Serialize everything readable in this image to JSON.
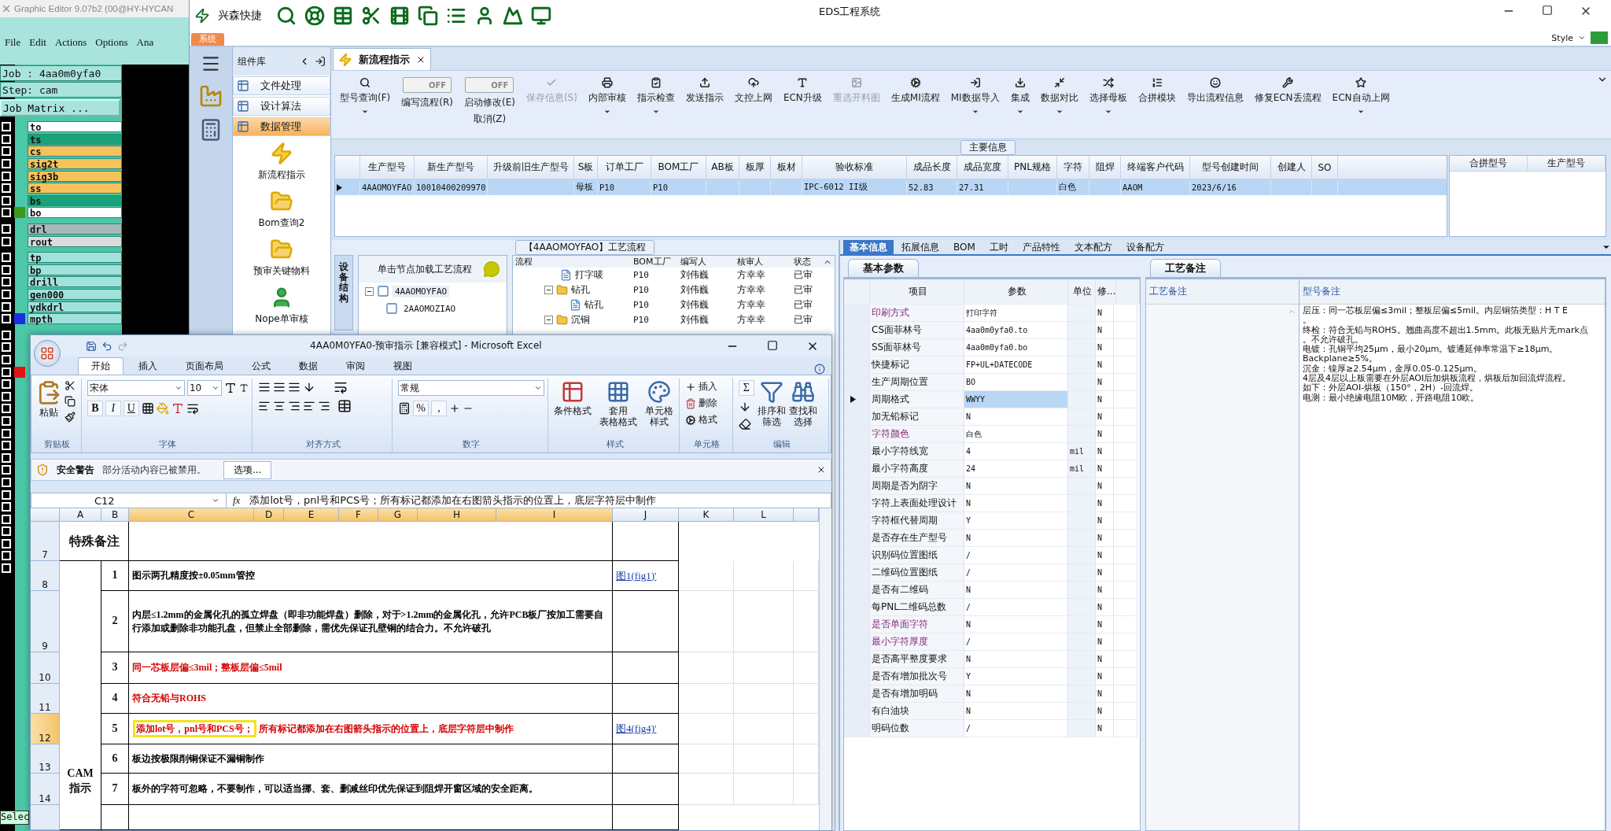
{
  "graphic_editor": {
    "title": "Graphic Editor 9.07b2 (00@HY-HYCAN",
    "menu": [
      "File",
      "Edit",
      "Actions",
      "Options",
      "Ana"
    ],
    "job": "Job : 4aa0m0yfa0",
    "step": "Step: cam",
    "matrix_button": "Job Matrix ...",
    "layer_groups": [
      [
        {
          "name": "to",
          "color": "#ffffff",
          "checked": false
        },
        {
          "name": "ts",
          "color": "#1aa37a",
          "checked": false
        },
        {
          "name": "cs",
          "color": "#f7c25a",
          "checked": false
        },
        {
          "name": "sig2t",
          "color": "#f7c25a",
          "checked": false
        },
        {
          "name": "sig3b",
          "color": "#f7c25a",
          "checked": false
        },
        {
          "name": "ss",
          "color": "#f7c25a",
          "checked": false
        },
        {
          "name": "bs",
          "color": "#1aa37a",
          "checked": false
        },
        {
          "name": "bo",
          "color": "#ffffff",
          "checked": false,
          "marker": {
            "color": "#3e9a1c"
          }
        }
      ],
      [
        {
          "name": "drl",
          "color": "#a9b9bb",
          "checked": false
        },
        {
          "name": "rout",
          "color": "#dcdcdc",
          "checked": false
        }
      ],
      [
        {
          "name": "tp",
          "color": "#a2e2dc",
          "checked": false
        },
        {
          "name": "bp",
          "color": "#a2e2dc",
          "checked": false
        },
        {
          "name": "drill",
          "color": "#a2e2dc",
          "checked": false
        },
        {
          "name": "gen000",
          "color": "#a2e2dc",
          "checked": false
        },
        {
          "name": "ydkdrl",
          "color": "#a2e2dc",
          "checked": false
        },
        {
          "name": "mpth",
          "color": "#a2e2dc",
          "checked": false,
          "marker": {
            "color": "#1c2fe0"
          }
        }
      ]
    ],
    "covered_layers": [
      {
        "checked": false
      },
      {
        "checked": false
      },
      {
        "checked": false
      },
      {
        "checked": false,
        "marker": {
          "color": "#e41414"
        }
      },
      {
        "checked": false
      },
      {
        "checked": false
      },
      {
        "checked": false
      },
      {
        "checked": false
      },
      {
        "checked": false
      },
      {
        "checked": false
      },
      {
        "checked": false
      },
      {
        "checked": false
      },
      {
        "checked": false
      },
      {
        "checked": false
      },
      {
        "checked": false
      },
      {
        "checked": false
      },
      {
        "checked": false
      },
      {
        "checked": false
      },
      {
        "checked": false
      },
      {
        "checked": false
      }
    ],
    "select_label": "Selec"
  },
  "eds": {
    "brand": "兴森快捷",
    "title": "EDS工程系统",
    "system_tab": "系统",
    "style_label": "Style",
    "library_title": "组件库",
    "nav_groups": [
      {
        "label": "文件处理",
        "selected": false
      },
      {
        "label": "设计算法",
        "selected": false
      },
      {
        "label": "数据管理",
        "selected": true
      }
    ],
    "modules": [
      "新流程指示",
      "Bom查询2",
      "预审关键物料",
      "Nope单审核"
    ],
    "doc_tab": "新流程指示",
    "ribbon": [
      {
        "kind": "button",
        "label": "型号查询(F)",
        "dropdown": true,
        "disabled": false
      },
      {
        "kind": "toggle",
        "label": "编写流程(R)",
        "state_text": "OFF",
        "on": false
      },
      {
        "kind": "toggle",
        "label": "启动修改(E)",
        "second_label": "取消(Z)",
        "state_text": "OFF",
        "on": false
      },
      {
        "kind": "button",
        "label": "保存信息(S)",
        "dropdown": false,
        "disabled": true
      },
      {
        "kind": "button",
        "label": "内部审核",
        "dropdown": true,
        "disabled": false
      },
      {
        "kind": "button",
        "label": "指示检查",
        "dropdown": true,
        "disabled": false
      },
      {
        "kind": "button",
        "label": "发送指示",
        "dropdown": false,
        "disabled": false
      },
      {
        "kind": "button",
        "label": "文控上网",
        "dropdown": false,
        "disabled": false
      },
      {
        "kind": "button",
        "label": "ECN升级",
        "dropdown": false,
        "disabled": false
      },
      {
        "kind": "button",
        "label": "重选开料图",
        "dropdown": false,
        "disabled": true
      },
      {
        "kind": "button",
        "label": "生成MI流程",
        "dropdown": false,
        "disabled": false
      },
      {
        "kind": "button",
        "label": "MI数据导入",
        "dropdown": true,
        "disabled": false
      },
      {
        "kind": "button",
        "label": "集成",
        "dropdown": true,
        "disabled": false
      },
      {
        "kind": "button",
        "label": "数据对比",
        "dropdown": true,
        "disabled": false
      },
      {
        "kind": "button",
        "label": "选择母板",
        "dropdown": true,
        "disabled": false
      },
      {
        "kind": "button",
        "label": "合拼模块",
        "dropdown": false,
        "disabled": false
      },
      {
        "kind": "button",
        "label": "导出流程信息",
        "dropdown": false,
        "disabled": false
      },
      {
        "kind": "button",
        "label": "修复ECN丢流程",
        "dropdown": false,
        "disabled": false
      },
      {
        "kind": "button",
        "label": "ECN自动上网",
        "dropdown": true,
        "disabled": false
      }
    ],
    "main_group": "主要信息",
    "main_table": {
      "columns": [
        "生产型号",
        "新生产型号",
        "升级前旧生产型号",
        "S板",
        "订单工厂",
        "BOM工厂",
        "AB板",
        "板厚",
        "板材",
        "验收标准",
        "成品长度",
        "成品宽度",
        "PNL规格",
        "字符",
        "阻焊",
        "终端客户代码",
        "型号创建时间",
        "创建人",
        "SO"
      ],
      "rows": [
        {
          "selected": true,
          "cells": [
            "4AAOMOYFAO",
            "10010400209970",
            null,
            "母板",
            "P10",
            "P10",
            null,
            null,
            null,
            "IPC-6012 II级",
            "52.83",
            "27.31",
            null,
            "白色",
            null,
            "AAOM",
            "2023/6/16",
            null,
            null
          ]
        }
      ]
    },
    "merge_table": {
      "columns": [
        "合拼型号",
        "生产型号"
      ]
    },
    "flow": {
      "title": "【4AAOMOYFAO】工艺流程",
      "side_tab": "设备结构",
      "hint": "单击节点加载工艺流程",
      "tree": [
        {
          "label": "4AAOMOYFAO",
          "selected": true,
          "expanded": true,
          "children": [
            {
              "label": "2AAOMOZIAO",
              "selected": false
            }
          ]
        }
      ],
      "columns": [
        "流程",
        "BOM工厂",
        "编写人",
        "核审人",
        "状态"
      ],
      "rows": [
        {
          "kind": "file",
          "cells": [
            "打字唛",
            "P10",
            "刘伟巍",
            "方幸幸",
            "已审"
          ]
        },
        {
          "kind": "folder",
          "expanded": true,
          "cells": [
            "钻孔",
            "P10",
            "刘伟巍",
            "方幸幸",
            "已审"
          ],
          "children": [
            {
              "kind": "file",
              "cells": [
                "钻孔",
                "P10",
                "刘伟巍",
                "方幸幸",
                "已审"
              ]
            }
          ]
        },
        {
          "kind": "folder",
          "expanded": true,
          "cells": [
            "沉铜",
            "P10",
            "刘伟巍",
            "方幸幸",
            "已审"
          ]
        }
      ]
    },
    "detail_tabs": [
      {
        "label": "基本信息",
        "selected": true
      },
      {
        "label": "拓展信息",
        "selected": false
      },
      {
        "label": "BOM",
        "selected": false
      },
      {
        "label": "工时",
        "selected": false
      },
      {
        "label": "产品特性",
        "selected": false
      },
      {
        "label": "文本配方",
        "selected": false
      },
      {
        "label": "设备配方",
        "selected": false
      }
    ],
    "params": {
      "title": "基本参数",
      "columns": [
        "项目",
        "参数",
        "单位",
        "修..."
      ],
      "rows": [
        {
          "item": "印刷方式",
          "value": "打印字符",
          "mod": "N",
          "flagged": true,
          "selected": false
        },
        {
          "item": "CS面菲林号",
          "value": "4aa0m0yfa0.to",
          "mod": "N",
          "flagged": false,
          "selected": false
        },
        {
          "item": "SS面菲林号",
          "value": "4aa0m0yfa0.bo",
          "mod": "N",
          "flagged": false,
          "selected": false
        },
        {
          "item": "快捷标记",
          "value": "FP+UL+DATECODE",
          "mod": "N",
          "flagged": false,
          "selected": false
        },
        {
          "item": "生产周期位置",
          "value": "BO",
          "mod": "N",
          "flagged": false,
          "selected": false
        },
        {
          "item": "周期格式",
          "value": "WWYY",
          "mod": "N",
          "flagged": false,
          "selected": true
        },
        {
          "item": "加无铅标记",
          "value": "N",
          "mod": "N",
          "flagged": false,
          "selected": false
        },
        {
          "item": "字符颜色",
          "value": "白色",
          "mod": "N",
          "flagged": true,
          "selected": false
        },
        {
          "item": "最小字符线宽",
          "value": "4",
          "unit": "mil",
          "mod": "N",
          "flagged": false,
          "selected": false
        },
        {
          "item": "最小字符高度",
          "value": "24",
          "unit": "mil",
          "mod": "N",
          "flagged": false,
          "selected": false
        },
        {
          "item": "周期是否为阴字",
          "value": "N",
          "mod": "N",
          "flagged": false,
          "selected": false
        },
        {
          "item": "字符上表面处理设计",
          "value": "N",
          "mod": "N",
          "flagged": false,
          "selected": false
        },
        {
          "item": "字符框代替周期",
          "value": "Y",
          "mod": "N",
          "flagged": false,
          "selected": false
        },
        {
          "item": "是否存在生产型号",
          "value": "N",
          "mod": "N",
          "flagged": false,
          "selected": false
        },
        {
          "item": "识别码位置图纸",
          "value": "/",
          "mod": "N",
          "flagged": false,
          "selected": false
        },
        {
          "item": "二维码位置图纸",
          "value": "/",
          "mod": "N",
          "flagged": false,
          "selected": false
        },
        {
          "item": "是否有二维码",
          "value": "N",
          "mod": "N",
          "flagged": false,
          "selected": false
        },
        {
          "item": "每PNL二维码总数",
          "value": "/",
          "mod": "N",
          "flagged": false,
          "selected": false
        },
        {
          "item": "是否单面字符",
          "value": "N",
          "mod": "N",
          "flagged": true,
          "selected": false
        },
        {
          "item": "最小字符厚度",
          "value": "/",
          "mod": "N",
          "flagged": true,
          "selected": false
        },
        {
          "item": "是否高平整度要求",
          "value": "N",
          "mod": "N",
          "flagged": false,
          "selected": false
        },
        {
          "item": "是否有增加批次号",
          "value": "Y",
          "mod": "N",
          "flagged": false,
          "selected": false
        },
        {
          "item": "是否有增加明码",
          "value": "N",
          "mod": "N",
          "flagged": false,
          "selected": false
        },
        {
          "item": "有白油块",
          "value": "N",
          "mod": "N",
          "flagged": false,
          "selected": false
        },
        {
          "item": "明码位数",
          "value": "/",
          "mod": "N",
          "flagged": false,
          "selected": false
        }
      ]
    },
    "notes": {
      "title": "工艺备注",
      "columns": [
        "工艺备注",
        "型号备注"
      ],
      "lines": [
        "层压：同一芯板层偏≤3mil；整板层偏≤5mil。内层铜箔类型：H T E",
        "。",
        "终检：符合无铅与ROHS。翘曲高度不超出1.5mm。此板无贴片无mark点",
        "。不允许破孔。",
        "电镀：孔铜平均25μm，最小20μm。镀通延伸率常温下≥18μm。",
        "Backplane≥5%。",
        "沉金：镍厚≥2.54μm，金厚0.05-0.125μm。",
        "4层及4层以上板需要在外层AOI后加烘板流程，烘板后加回流焊流程。",
        "如下：外层AOI-烘板（150°，2H）-回流焊。",
        "电测：最小绝缘电阻10M欧，开路电阻10欧。"
      ]
    }
  },
  "excel": {
    "title": "4AA0M0YFA0-预审指示  [兼容模式] - Microsoft Excel",
    "tabs": [
      {
        "label": "开始",
        "selected": true
      },
      {
        "label": "插入",
        "selected": false
      },
      {
        "label": "页面布局",
        "selected": false
      },
      {
        "label": "公式",
        "selected": false
      },
      {
        "label": "数据",
        "selected": false
      },
      {
        "label": "审阅",
        "selected": false
      },
      {
        "label": "视图",
        "selected": false
      }
    ],
    "ribbon": {
      "paste": "粘贴",
      "font": "宋体",
      "size": "10",
      "style_buttons": [
        "B",
        "I",
        "U"
      ],
      "number_format": "常规",
      "number_buttons": [
        "%",
        ","
      ],
      "styles": [
        [
          "条件格式"
        ],
        [
          "套用",
          "表格格式"
        ],
        [
          "单元格",
          "样式"
        ]
      ],
      "cells": [
        "插入",
        "删除",
        "格式"
      ],
      "sum": "Σ",
      "edit": [
        [
          "排序和",
          "筛选"
        ],
        [
          "查找和",
          "选择"
        ]
      ],
      "groups": [
        "剪贴板",
        "字体",
        "对齐方式",
        "数字",
        "样式",
        "单元格",
        "编辑"
      ]
    },
    "security": {
      "title": "安全警告",
      "message": "部分活动内容已被禁用。",
      "button": "选项..."
    },
    "name_box": "C12",
    "fx_label": "fx",
    "formula": "添加lot号，pnl号和PCS号；所有标记都添加在右图箭头指示的位置上，底层字符层中制作",
    "columns": [
      {
        "label": "A",
        "selected": false
      },
      {
        "label": "B",
        "selected": false
      },
      {
        "label": "C",
        "selected": true
      },
      {
        "label": "D",
        "selected": true
      },
      {
        "label": "E",
        "selected": true
      },
      {
        "label": "F",
        "selected": true
      },
      {
        "label": "G",
        "selected": true
      },
      {
        "label": "H",
        "selected": true
      },
      {
        "label": "I",
        "selected": true
      },
      {
        "label": "J",
        "selected": false
      },
      {
        "label": "K",
        "selected": false
      },
      {
        "label": "L",
        "selected": false
      }
    ],
    "section_row": "7",
    "section": "特殊备注",
    "side_label": "CAM 指示",
    "items": [
      {
        "row": "8",
        "num": "1",
        "text": "图示两孔精度按±0.05mm管控",
        "red": false,
        "link": "图1(fig1)'",
        "selected": false
      },
      {
        "row": "9",
        "num": "2",
        "text": "内层≤1.2mm的金属化孔的孤立焊盘（即非功能焊盘）删除，对于>1.2mm的金属化孔，允许PCB板厂按加工需要自行添加或删除非功能孔盘，但禁止全部删除，需优先保证孔壁铜的结合力。不允许破孔",
        "red": false,
        "selected": false
      },
      {
        "row": "10",
        "num": "3",
        "text": "同一芯板层偏≤3mil；整板层偏≤5mil",
        "red": true,
        "selected": false
      },
      {
        "row": "11",
        "num": "4",
        "text": "符合无铅与ROHS",
        "red": true,
        "selected": false
      },
      {
        "row": "12",
        "num": "5",
        "boxed_text": "添加lot号，pnl号和PCS号；",
        "text": "所有标记都添加在右图箭头指示的位置上，底层字符层中制作",
        "red": true,
        "link": "图4(fig4)'",
        "selected": true
      },
      {
        "row": "13",
        "num": "6",
        "text": "板边按极限削铜保证不漏铜制作",
        "red": false,
        "selected": false
      },
      {
        "row": "14",
        "num": "7",
        "text": "板外的字符可忽略，不要制作，可以适当挪、套、删减丝印优先保证到阻焊开窗区域的安全距离。",
        "red": false,
        "selected": false
      }
    ]
  }
}
